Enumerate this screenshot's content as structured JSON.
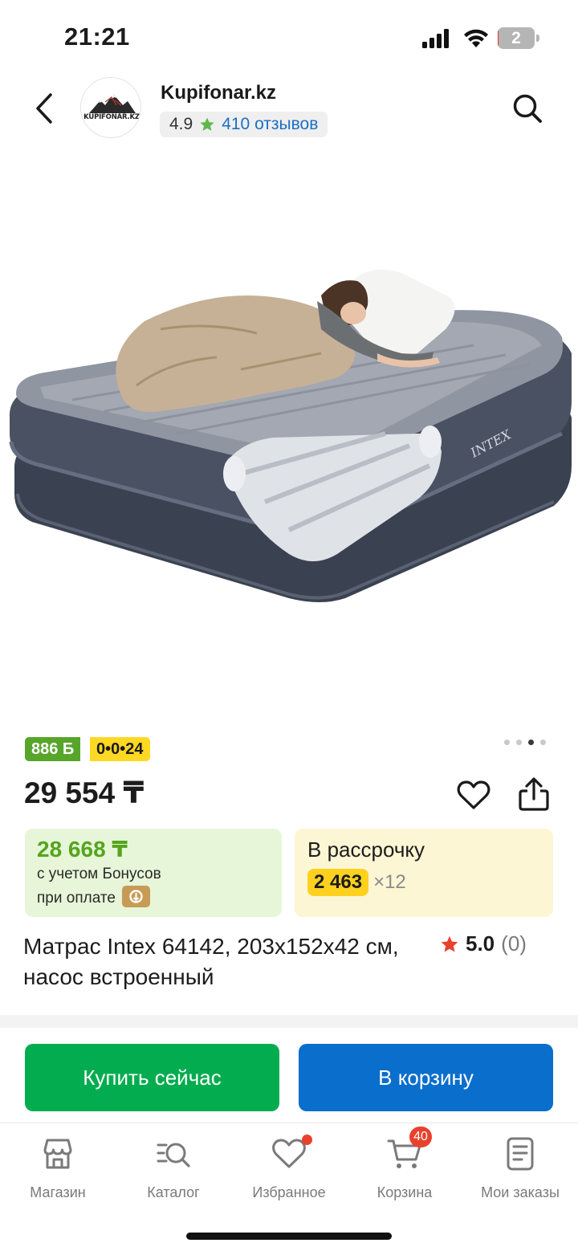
{
  "status_bar": {
    "time": "21:21",
    "battery_level": "2",
    "battery_percent": 2
  },
  "header": {
    "store_name": "Kupifonar.kz",
    "store_logo_text": "KUPIFONAR.KZ",
    "rating": "4.9",
    "reviews_link": "410 отзывов"
  },
  "gallery": {
    "image_count": 4,
    "active_index": 3
  },
  "product": {
    "bonus_badge": "886 Б",
    "installment_badge": "0•0•24",
    "price": "29 554 ₸",
    "title": "Матрас Intex 64142, 203x152x42 см, насос встроенный",
    "rating": "5.0",
    "rating_count": "(0)"
  },
  "bonus_card": {
    "price": "28 668 ₸",
    "line1": "с учетом Бонусов",
    "line2": "при оплате"
  },
  "installment_card": {
    "title": "В рассрочку",
    "amount": "2 463",
    "times": "×12"
  },
  "actions": {
    "buy_now": "Купить сейчас",
    "add_to_cart": "В корзину"
  },
  "tab_bar": {
    "items": [
      {
        "label": "Магазин",
        "icon": "store-icon"
      },
      {
        "label": "Каталог",
        "icon": "catalog-search-icon"
      },
      {
        "label": "Избранное",
        "icon": "heart-icon"
      },
      {
        "label": "Корзина",
        "icon": "cart-icon"
      },
      {
        "label": "Мои заказы",
        "icon": "orders-icon"
      }
    ],
    "cart_count": "40"
  },
  "colors": {
    "bonus_green": "#58a52b",
    "installment_yellow": "#ffd824",
    "buy_green": "#03ad4f",
    "cart_blue": "#0a6ecc",
    "link_blue": "#1b6fc2",
    "notification_red": "#e8412d"
  }
}
